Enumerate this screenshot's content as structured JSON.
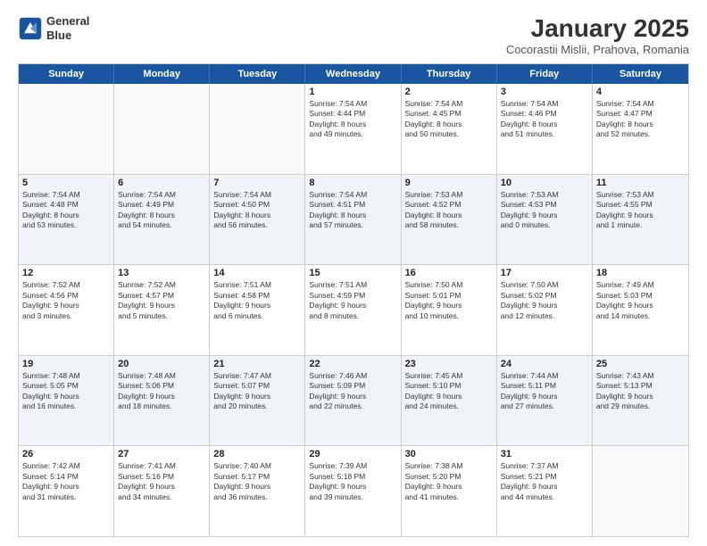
{
  "header": {
    "logo_line1": "General",
    "logo_line2": "Blue",
    "month_title": "January 2025",
    "subtitle": "Cocorastii Mislii, Prahova, Romania"
  },
  "day_names": [
    "Sunday",
    "Monday",
    "Tuesday",
    "Wednesday",
    "Thursday",
    "Friday",
    "Saturday"
  ],
  "rows": [
    {
      "alt": false,
      "cells": [
        {
          "date": "",
          "info": ""
        },
        {
          "date": "",
          "info": ""
        },
        {
          "date": "",
          "info": ""
        },
        {
          "date": "1",
          "info": "Sunrise: 7:54 AM\nSunset: 4:44 PM\nDaylight: 8 hours\nand 49 minutes."
        },
        {
          "date": "2",
          "info": "Sunrise: 7:54 AM\nSunset: 4:45 PM\nDaylight: 8 hours\nand 50 minutes."
        },
        {
          "date": "3",
          "info": "Sunrise: 7:54 AM\nSunset: 4:46 PM\nDaylight: 8 hours\nand 51 minutes."
        },
        {
          "date": "4",
          "info": "Sunrise: 7:54 AM\nSunset: 4:47 PM\nDaylight: 8 hours\nand 52 minutes."
        }
      ]
    },
    {
      "alt": true,
      "cells": [
        {
          "date": "5",
          "info": "Sunrise: 7:54 AM\nSunset: 4:48 PM\nDaylight: 8 hours\nand 53 minutes."
        },
        {
          "date": "6",
          "info": "Sunrise: 7:54 AM\nSunset: 4:49 PM\nDaylight: 8 hours\nand 54 minutes."
        },
        {
          "date": "7",
          "info": "Sunrise: 7:54 AM\nSunset: 4:50 PM\nDaylight: 8 hours\nand 56 minutes."
        },
        {
          "date": "8",
          "info": "Sunrise: 7:54 AM\nSunset: 4:51 PM\nDaylight: 8 hours\nand 57 minutes."
        },
        {
          "date": "9",
          "info": "Sunrise: 7:53 AM\nSunset: 4:52 PM\nDaylight: 8 hours\nand 58 minutes."
        },
        {
          "date": "10",
          "info": "Sunrise: 7:53 AM\nSunset: 4:53 PM\nDaylight: 9 hours\nand 0 minutes."
        },
        {
          "date": "11",
          "info": "Sunrise: 7:53 AM\nSunset: 4:55 PM\nDaylight: 9 hours\nand 1 minute."
        }
      ]
    },
    {
      "alt": false,
      "cells": [
        {
          "date": "12",
          "info": "Sunrise: 7:52 AM\nSunset: 4:56 PM\nDaylight: 9 hours\nand 3 minutes."
        },
        {
          "date": "13",
          "info": "Sunrise: 7:52 AM\nSunset: 4:57 PM\nDaylight: 9 hours\nand 5 minutes."
        },
        {
          "date": "14",
          "info": "Sunrise: 7:51 AM\nSunset: 4:58 PM\nDaylight: 9 hours\nand 6 minutes."
        },
        {
          "date": "15",
          "info": "Sunrise: 7:51 AM\nSunset: 4:59 PM\nDaylight: 9 hours\nand 8 minutes."
        },
        {
          "date": "16",
          "info": "Sunrise: 7:50 AM\nSunset: 5:01 PM\nDaylight: 9 hours\nand 10 minutes."
        },
        {
          "date": "17",
          "info": "Sunrise: 7:50 AM\nSunset: 5:02 PM\nDaylight: 9 hours\nand 12 minutes."
        },
        {
          "date": "18",
          "info": "Sunrise: 7:49 AM\nSunset: 5:03 PM\nDaylight: 9 hours\nand 14 minutes."
        }
      ]
    },
    {
      "alt": true,
      "cells": [
        {
          "date": "19",
          "info": "Sunrise: 7:48 AM\nSunset: 5:05 PM\nDaylight: 9 hours\nand 16 minutes."
        },
        {
          "date": "20",
          "info": "Sunrise: 7:48 AM\nSunset: 5:06 PM\nDaylight: 9 hours\nand 18 minutes."
        },
        {
          "date": "21",
          "info": "Sunrise: 7:47 AM\nSunset: 5:07 PM\nDaylight: 9 hours\nand 20 minutes."
        },
        {
          "date": "22",
          "info": "Sunrise: 7:46 AM\nSunset: 5:09 PM\nDaylight: 9 hours\nand 22 minutes."
        },
        {
          "date": "23",
          "info": "Sunrise: 7:45 AM\nSunset: 5:10 PM\nDaylight: 9 hours\nand 24 minutes."
        },
        {
          "date": "24",
          "info": "Sunrise: 7:44 AM\nSunset: 5:11 PM\nDaylight: 9 hours\nand 27 minutes."
        },
        {
          "date": "25",
          "info": "Sunrise: 7:43 AM\nSunset: 5:13 PM\nDaylight: 9 hours\nand 29 minutes."
        }
      ]
    },
    {
      "alt": false,
      "cells": [
        {
          "date": "26",
          "info": "Sunrise: 7:42 AM\nSunset: 5:14 PM\nDaylight: 9 hours\nand 31 minutes."
        },
        {
          "date": "27",
          "info": "Sunrise: 7:41 AM\nSunset: 5:16 PM\nDaylight: 9 hours\nand 34 minutes."
        },
        {
          "date": "28",
          "info": "Sunrise: 7:40 AM\nSunset: 5:17 PM\nDaylight: 9 hours\nand 36 minutes."
        },
        {
          "date": "29",
          "info": "Sunrise: 7:39 AM\nSunset: 5:18 PM\nDaylight: 9 hours\nand 39 minutes."
        },
        {
          "date": "30",
          "info": "Sunrise: 7:38 AM\nSunset: 5:20 PM\nDaylight: 9 hours\nand 41 minutes."
        },
        {
          "date": "31",
          "info": "Sunrise: 7:37 AM\nSunset: 5:21 PM\nDaylight: 9 hours\nand 44 minutes."
        },
        {
          "date": "",
          "info": ""
        }
      ]
    }
  ]
}
